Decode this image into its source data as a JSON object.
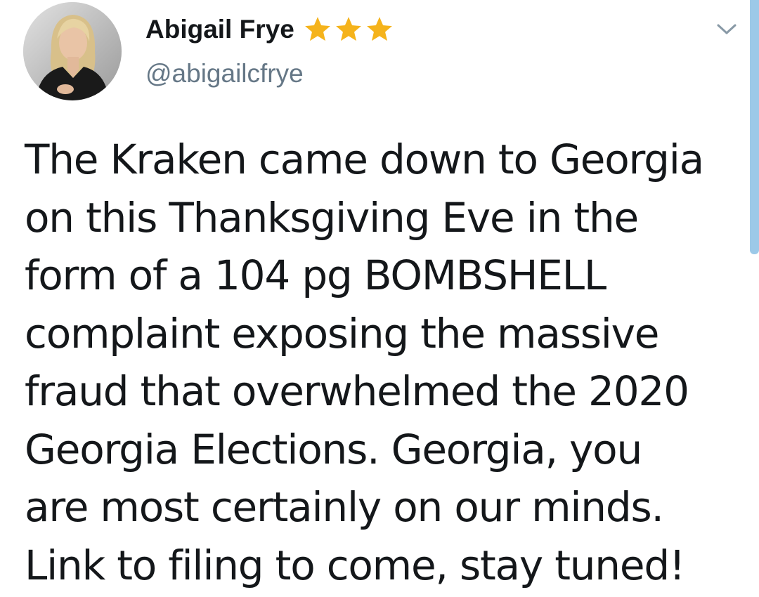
{
  "tweet": {
    "author": {
      "display_name": "Abigail Frye",
      "handle": "@abigailcfrye",
      "badge_stars": [
        "star-icon",
        "star-icon",
        "star-icon"
      ],
      "badge_color": "#f5b31b"
    },
    "menu_icon": "chevron-down-icon",
    "text_lines": [
      "The Kraken came down to Georgia",
      "on this Thanksgiving Eve in the",
      "form of a 104 pg BOMBSHELL",
      "complaint exposing the massive",
      "fraud that overwhelmed the 2020",
      "Georgia Elections. Georgia, you",
      "are most certainly on our minds.",
      "Link to filing to come, stay tuned!"
    ]
  },
  "colors": {
    "text": "#14171a",
    "secondary": "#657786",
    "scrollbar": "#9cc9e8"
  }
}
